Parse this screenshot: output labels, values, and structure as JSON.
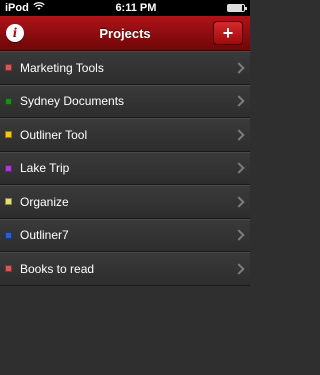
{
  "status_bar": {
    "carrier": "iPod",
    "time": "6:11 PM",
    "battery_level": 0.9
  },
  "nav": {
    "title": "Projects",
    "info_icon": "info-icon",
    "add_label": "+"
  },
  "projects": [
    {
      "label": "Marketing Tools",
      "color": "#d8585a"
    },
    {
      "label": "Sydney Documents",
      "color": "#1f8a1f"
    },
    {
      "label": "Outliner Tool",
      "color": "#f2c81a"
    },
    {
      "label": "Lake Trip",
      "color": "#a63bd8"
    },
    {
      "label": "Organize",
      "color": "#e6df73"
    },
    {
      "label": "Outliner7",
      "color": "#2b5fd0"
    },
    {
      "label": "Books to read",
      "color": "#d8585a"
    }
  ]
}
